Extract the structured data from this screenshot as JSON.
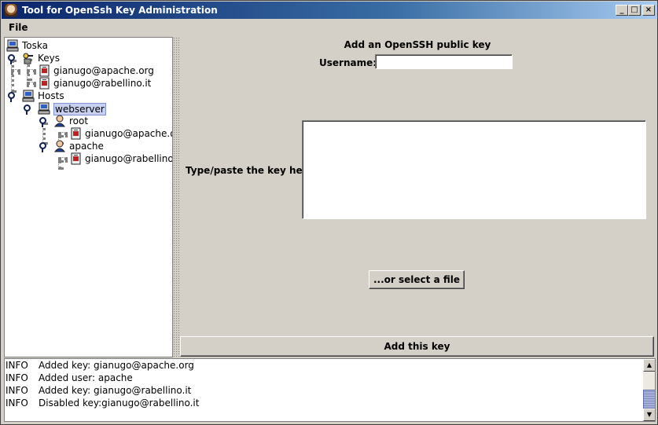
{
  "window": {
    "title": "Tool for OpenSsh Key Administration",
    "controls": {
      "minimize": "_",
      "maximize": "□",
      "close": "×"
    }
  },
  "menu": {
    "file": "File"
  },
  "tree": {
    "root": "Toska",
    "keys_label": "Keys",
    "keys": [
      "gianugo@apache.org",
      "gianugo@rabellino.it"
    ],
    "hosts_label": "Hosts",
    "host": "webserver",
    "users": [
      {
        "name": "root",
        "key": "gianugo@apache.or"
      },
      {
        "name": "apache",
        "key": "gianugo@rabellino.i"
      }
    ]
  },
  "form": {
    "title": "Add an OpenSSH public key",
    "username_label": "Username:",
    "username_value": "",
    "key_label": "Type/paste the key here:",
    "key_value": "",
    "file_button": "...or select a file",
    "add_button": "Add this key"
  },
  "log": [
    {
      "level": "INFO",
      "message": "Added key: gianugo@apache.org"
    },
    {
      "level": "INFO",
      "message": "Added user: apache"
    },
    {
      "level": "INFO",
      "message": "Added key: gianugo@rabellino.it"
    },
    {
      "level": "INFO",
      "message": "Disabled key:gianugo@rabellino.it"
    }
  ],
  "scrollbar": {
    "up": "▲",
    "down": "▼"
  }
}
